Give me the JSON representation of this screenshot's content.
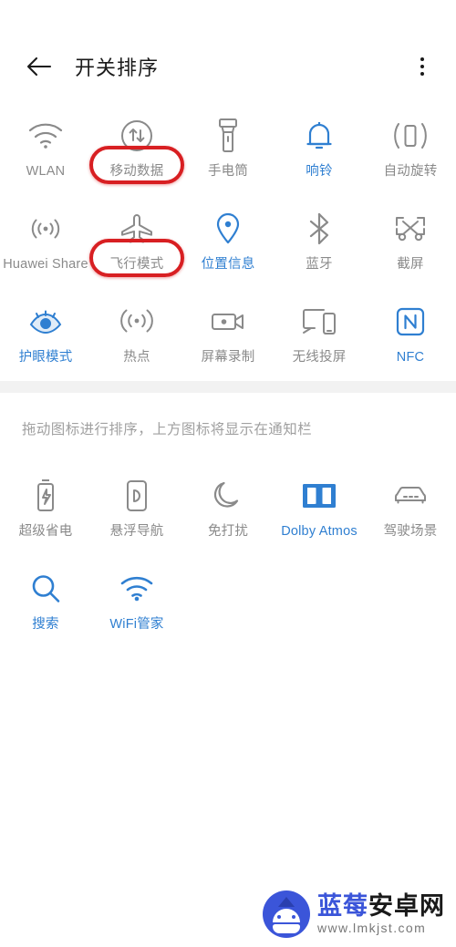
{
  "header": {
    "title": "开关排序",
    "back_icon": "arrow-left-icon",
    "more_icon": "overflow-menu-icon"
  },
  "hint": {
    "text": "拖动图标进行排序，上方图标将显示在通知栏"
  },
  "colors": {
    "active": "#2f7fd1",
    "inactive": "#8a8a8a",
    "highlight_ring": "#d81f22",
    "title": "#1a1a1a",
    "band": "#f2f2f2",
    "hint": "#a0a0a0"
  },
  "top_grid": {
    "columns": 5,
    "tiles": [
      {
        "label": "WLAN",
        "icon": "wifi-icon",
        "state": "off",
        "highlighted": false
      },
      {
        "label": "移动数据",
        "icon": "mobile-data-icon",
        "state": "off",
        "highlighted": true
      },
      {
        "label": "手电筒",
        "icon": "flashlight-icon",
        "state": "off",
        "highlighted": false
      },
      {
        "label": "响铃",
        "icon": "bell-icon",
        "state": "on",
        "highlighted": false
      },
      {
        "label": "自动旋转",
        "icon": "auto-rotate-icon",
        "state": "off",
        "highlighted": false
      },
      {
        "label": "Huawei Share",
        "icon": "huawei-share-icon",
        "state": "off",
        "highlighted": false
      },
      {
        "label": "飞行模式",
        "icon": "airplane-icon",
        "state": "off",
        "highlighted": true
      },
      {
        "label": "位置信息",
        "icon": "location-pin-icon",
        "state": "on",
        "highlighted": false
      },
      {
        "label": "蓝牙",
        "icon": "bluetooth-icon",
        "state": "off",
        "highlighted": false
      },
      {
        "label": "截屏",
        "icon": "screenshot-icon",
        "state": "off",
        "highlighted": false
      },
      {
        "label": "护眼模式",
        "icon": "eye-comfort-icon",
        "state": "on",
        "highlighted": false
      },
      {
        "label": "热点",
        "icon": "hotspot-icon",
        "state": "off",
        "highlighted": false
      },
      {
        "label": "屏幕录制",
        "icon": "screen-record-icon",
        "state": "off",
        "highlighted": false
      },
      {
        "label": "无线投屏",
        "icon": "wireless-cast-icon",
        "state": "off",
        "highlighted": false
      },
      {
        "label": "NFC",
        "icon": "nfc-icon",
        "state": "on",
        "highlighted": false
      }
    ]
  },
  "bottom_grid": {
    "columns": 5,
    "tiles": [
      {
        "label": "超级省电",
        "icon": "battery-saver-icon",
        "state": "off"
      },
      {
        "label": "悬浮导航",
        "icon": "floating-nav-icon",
        "state": "off"
      },
      {
        "label": "免打扰",
        "icon": "do-not-disturb-icon",
        "state": "off"
      },
      {
        "label": "Dolby Atmos",
        "icon": "dolby-atmos-icon",
        "state": "on"
      },
      {
        "label": "驾驶场景",
        "icon": "car-icon",
        "state": "off"
      },
      {
        "label": "搜索",
        "icon": "search-icon",
        "state": "on"
      },
      {
        "label": "WiFi管家",
        "icon": "wifi-manager-icon",
        "state": "on"
      }
    ]
  },
  "watermark": {
    "brand_blue": "蓝莓",
    "brand_black": "安卓网",
    "url": "www.lmkjst.com",
    "logo_icon": "blueberry-android-logo"
  }
}
